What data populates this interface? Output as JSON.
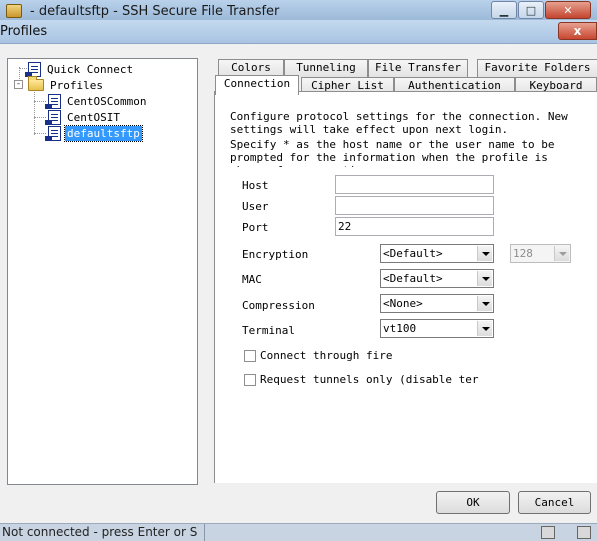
{
  "app": {
    "title": "- defaultsftp - SSH Secure File Transfer",
    "status": "Not connected - press Enter or S"
  },
  "dialog": {
    "title": "Profiles",
    "close_glyph": "x",
    "ok_label": "OK",
    "cancel_label": "Cancel"
  },
  "tree": {
    "quick_connect": "Quick Connect",
    "profiles": "Profiles",
    "expander": "-",
    "items": [
      "CentOSCommon",
      "CentOSIT",
      "defaultsftp"
    ],
    "selected": "defaultsftp"
  },
  "tabs": {
    "back_row": [
      "Colors",
      "Tunneling",
      "File Transfer",
      "Favorite Folders"
    ],
    "front_row": [
      "Connection",
      "Cipher List",
      "Authentication",
      "Keyboard"
    ],
    "active": "Connection"
  },
  "connection": {
    "desc1": "Configure protocol settings for the connection. New settings will take effect upon next login.",
    "desc2": "Specify * as the host name or the user name to be prompted for the information when the profile is chosen for connection.",
    "host_label": "Host",
    "host_value": "",
    "user_label": "User",
    "user_value": "",
    "port_label": "Port",
    "port_value": "22",
    "encryption_label": "Encryption",
    "encryption_value": "<Default>",
    "key_length_value": "128",
    "mac_label": "MAC",
    "mac_value": "<Default>",
    "compression_label": "Compression",
    "compression_value": "<None>",
    "terminal_label": "Terminal",
    "terminal_value": "vt100",
    "firewall_label": "Connect through fire",
    "tunnels_label": "Request tunnels only (disable ter"
  },
  "icons": [
    "app-icon",
    "minimize-icon",
    "maximize-icon",
    "close-icon",
    "document-icon",
    "folder-icon",
    "mouse-cursor-icon",
    "dropdown-arrow-icon"
  ]
}
